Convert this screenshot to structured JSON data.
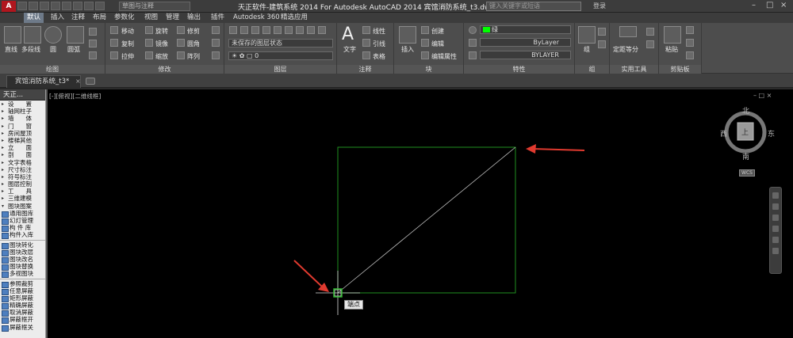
{
  "titlebar": {
    "logo": "A",
    "workspace": "草图与注释",
    "title": "天正软件-建筑系统 2014  For Autodesk AutoCAD 2014    宾馆消防系统_t3.dwg",
    "search_placeholder": "键入关键字或短语",
    "login": "登录"
  },
  "menu": {
    "tabs": [
      "默认",
      "插入",
      "注释",
      "布局",
      "参数化",
      "视图",
      "管理",
      "输出",
      "插件",
      "Autodesk 360",
      "精选应用"
    ]
  },
  "ribbon": {
    "draw": {
      "title": "绘图",
      "line": "直线",
      "polyline": "多段线",
      "circle": "圆",
      "arc": "圆弧"
    },
    "modify": {
      "title": "修改",
      "move": "移动",
      "rotate": "旋转",
      "trim": "修剪",
      "copy": "复制",
      "mirror": "镜像",
      "fillet": "圆角",
      "stretch": "拉伸",
      "scale": "缩放",
      "array": "阵列"
    },
    "layers": {
      "title": "图层",
      "state": "未保存的图层状态",
      "current": "0"
    },
    "annotation": {
      "title": "注释",
      "text": "文字",
      "dim_linear": "线性",
      "leader": "引线",
      "table": "表格"
    },
    "block": {
      "title": "块",
      "insert": "插入",
      "create": "创建",
      "edit": "编辑",
      "edit_attr": "编辑属性"
    },
    "properties": {
      "title": "特性",
      "color": "绿",
      "linetype": "ByLayer",
      "lineweight": "BYLAYER"
    },
    "groups": {
      "title": "组",
      "group": "组"
    },
    "utilities": {
      "title": "实用工具",
      "measure": "定距等分"
    },
    "clipboard": {
      "title": "剪贴板",
      "paste": "粘贴"
    }
  },
  "doc_tab": {
    "label": "宾馆消防系统_t3*",
    "close": "×"
  },
  "palette": {
    "header": "天正...",
    "items": [
      "设　　置",
      "轴网柱子",
      "墙　　体",
      "门　　窗",
      "房间屋顶",
      "楼梯其他",
      "立　　面",
      "剖　　面",
      "文字表格",
      "尺寸标注",
      "符号标注",
      "图层控制",
      "工　　具",
      "三维建模"
    ],
    "open_item": "图块图案",
    "sub_items_a": [
      "通用图库",
      "幻灯管理",
      "构 件 库",
      "构件入库"
    ],
    "sub_items_b": [
      "图块转化",
      "图块改层",
      "图块改名",
      "图块替换",
      "多视图块"
    ],
    "sub_items_c": [
      "参照裁剪",
      "任意屏蔽",
      "矩形屏蔽",
      "精确屏蔽",
      "取消屏蔽",
      "屏蔽框开",
      "屏蔽框关"
    ]
  },
  "canvas": {
    "view_label": "[-][俯视][二维线框]",
    "window_controls": "–  □  ×",
    "tooltip": "端点",
    "compass": {
      "n": "北",
      "s": "南",
      "e": "东",
      "w": "西",
      "center": "上"
    },
    "wcs": "WCS"
  },
  "colors": {
    "rect": "#1f8f1f",
    "diagonal": "#c8c8c8",
    "arrow": "#e03a2f",
    "green_swatch": "#00ff00"
  }
}
